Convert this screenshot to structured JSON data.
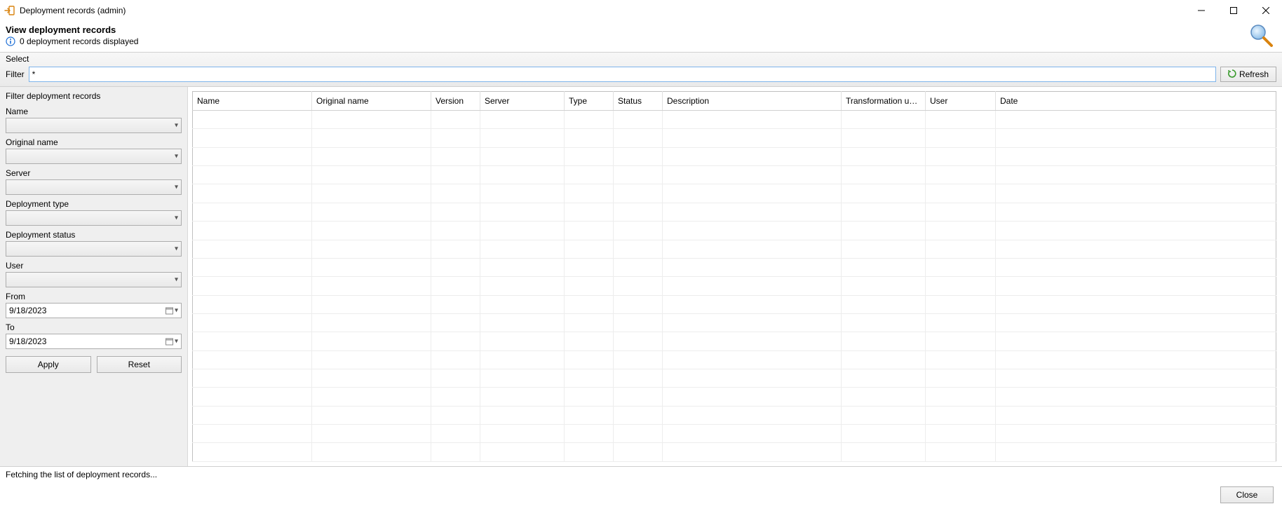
{
  "window": {
    "title": "Deployment records (admin)"
  },
  "header": {
    "title": "View deployment records",
    "subtitle": "0 deployment records displayed"
  },
  "filterbar": {
    "section_label": "Select",
    "filter_label": "Filter",
    "filter_value": "*",
    "refresh_label": "Refresh"
  },
  "sidebar": {
    "title": "Filter deployment records",
    "fields": {
      "name": {
        "label": "Name",
        "value": ""
      },
      "original_name": {
        "label": "Original name",
        "value": ""
      },
      "server": {
        "label": "Server",
        "value": ""
      },
      "deployment_type": {
        "label": "Deployment type",
        "value": ""
      },
      "deployment_status": {
        "label": "Deployment status",
        "value": ""
      },
      "user": {
        "label": "User",
        "value": ""
      },
      "from": {
        "label": "From",
        "value": "9/18/2023"
      },
      "to": {
        "label": "To",
        "value": "9/18/2023"
      }
    },
    "apply_label": "Apply",
    "reset_label": "Reset"
  },
  "table": {
    "columns": [
      "Name",
      "Original name",
      "Version",
      "Server",
      "Type",
      "Status",
      "Description",
      "Transformation used?",
      "User",
      "Date"
    ],
    "rows": []
  },
  "status": "Fetching the list of deployment records...",
  "footer": {
    "close_label": "Close"
  }
}
